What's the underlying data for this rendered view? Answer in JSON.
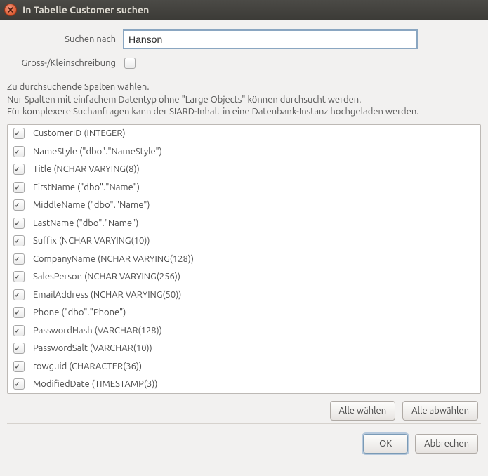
{
  "titlebar": {
    "title": "In Tabelle Customer suchen"
  },
  "search": {
    "label": "Suchen nach",
    "value": "Hanson",
    "placeholder": ""
  },
  "case_sensitive": {
    "label": "Gross-/Kleinschreibung",
    "checked": false
  },
  "instructions": {
    "line1": "Zu durchsuchende Spalten wählen.",
    "line2": "Nur Spalten mit einfachem Datentyp ohne \"Large Objects\" können durchsucht werden.",
    "line3": "Für komplexere Suchanfragen kann der SIARD-Inhalt in eine Datenbank-Instanz hochgeladen werden."
  },
  "columns": [
    {
      "label": "CustomerID (INTEGER)",
      "checked": true
    },
    {
      "label": "NameStyle (\"dbo\".\"NameStyle\")",
      "checked": true
    },
    {
      "label": "Title (NCHAR VARYING(8))",
      "checked": true
    },
    {
      "label": "FirstName (\"dbo\".\"Name\")",
      "checked": true
    },
    {
      "label": "MiddleName (\"dbo\".\"Name\")",
      "checked": true
    },
    {
      "label": "LastName (\"dbo\".\"Name\")",
      "checked": true
    },
    {
      "label": "Suffix (NCHAR VARYING(10))",
      "checked": true
    },
    {
      "label": "CompanyName (NCHAR VARYING(128))",
      "checked": true
    },
    {
      "label": "SalesPerson (NCHAR VARYING(256))",
      "checked": true
    },
    {
      "label": "EmailAddress (NCHAR VARYING(50))",
      "checked": true
    },
    {
      "label": "Phone (\"dbo\".\"Phone\")",
      "checked": true
    },
    {
      "label": "PasswordHash (VARCHAR(128))",
      "checked": true
    },
    {
      "label": "PasswordSalt (VARCHAR(10))",
      "checked": true
    },
    {
      "label": "rowguid (CHARACTER(36))",
      "checked": true
    },
    {
      "label": "ModifiedDate (TIMESTAMP(3))",
      "checked": true
    }
  ],
  "buttons": {
    "select_all": "Alle wählen",
    "deselect_all": "Alle abwählen",
    "ok": "OK",
    "cancel": "Abbrechen"
  }
}
